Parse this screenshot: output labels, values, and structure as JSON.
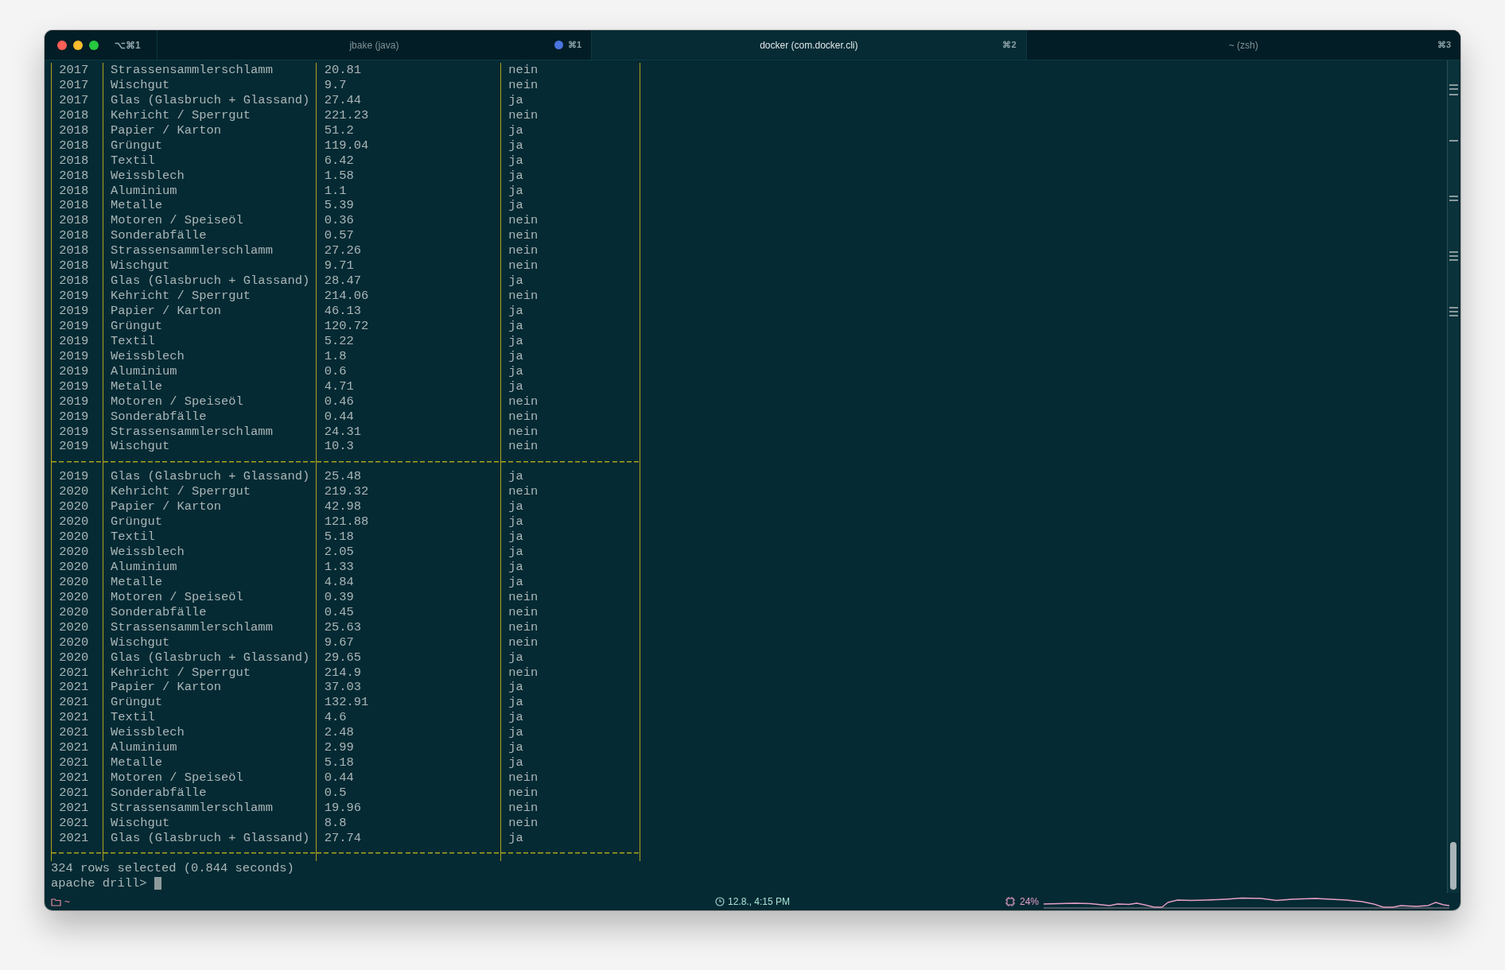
{
  "window": {
    "shortcut": "⌥⌘1"
  },
  "tabs": [
    {
      "title": "jbake (java)",
      "shortcut": "⌘1",
      "activity": true,
      "selected": false
    },
    {
      "title": "docker (com.docker.cli)",
      "shortcut": "⌘2",
      "activity": false,
      "selected": true
    },
    {
      "title": "~ (zsh)",
      "shortcut": "⌘3",
      "activity": false,
      "selected": false
    }
  ],
  "terminal": {
    "lines": [
      {
        "kind": "row",
        "cells": [
          "2017",
          "Strassensammlerschlamm",
          "20.81",
          "nein"
        ]
      },
      {
        "kind": "row",
        "cells": [
          "2017",
          "Wischgut",
          "9.7",
          "nein"
        ]
      },
      {
        "kind": "row",
        "cells": [
          "2017",
          "Glas (Glasbruch + Glassand)",
          "27.44",
          "ja"
        ]
      },
      {
        "kind": "row",
        "cells": [
          "2018",
          "Kehricht / Sperrgut",
          "221.23",
          "nein"
        ]
      },
      {
        "kind": "row",
        "cells": [
          "2018",
          "Papier / Karton",
          "51.2",
          "ja"
        ]
      },
      {
        "kind": "row",
        "cells": [
          "2018",
          "Grüngut",
          "119.04",
          "ja"
        ]
      },
      {
        "kind": "row",
        "cells": [
          "2018",
          "Textil",
          "6.42",
          "ja"
        ]
      },
      {
        "kind": "row",
        "cells": [
          "2018",
          "Weissblech",
          "1.58",
          "ja"
        ]
      },
      {
        "kind": "row",
        "cells": [
          "2018",
          "Aluminium",
          "1.1",
          "ja"
        ]
      },
      {
        "kind": "row",
        "cells": [
          "2018",
          "Metalle",
          "5.39",
          "ja"
        ]
      },
      {
        "kind": "row",
        "cells": [
          "2018",
          "Motoren / Speiseöl",
          "0.36",
          "nein"
        ]
      },
      {
        "kind": "row",
        "cells": [
          "2018",
          "Sonderabfälle",
          "0.57",
          "nein"
        ]
      },
      {
        "kind": "row",
        "cells": [
          "2018",
          "Strassensammlerschlamm",
          "27.26",
          "nein"
        ]
      },
      {
        "kind": "row",
        "cells": [
          "2018",
          "Wischgut",
          "9.71",
          "nein"
        ]
      },
      {
        "kind": "row",
        "cells": [
          "2018",
          "Glas (Glasbruch + Glassand)",
          "28.47",
          "ja"
        ]
      },
      {
        "kind": "row",
        "cells": [
          "2019",
          "Kehricht / Sperrgut",
          "214.06",
          "nein"
        ]
      },
      {
        "kind": "row",
        "cells": [
          "2019",
          "Papier / Karton",
          "46.13",
          "ja"
        ]
      },
      {
        "kind": "row",
        "cells": [
          "2019",
          "Grüngut",
          "120.72",
          "ja"
        ]
      },
      {
        "kind": "row",
        "cells": [
          "2019",
          "Textil",
          "5.22",
          "ja"
        ]
      },
      {
        "kind": "row",
        "cells": [
          "2019",
          "Weissblech",
          "1.8",
          "ja"
        ]
      },
      {
        "kind": "row",
        "cells": [
          "2019",
          "Aluminium",
          "0.6",
          "ja"
        ]
      },
      {
        "kind": "row",
        "cells": [
          "2019",
          "Metalle",
          "4.71",
          "ja"
        ]
      },
      {
        "kind": "row",
        "cells": [
          "2019",
          "Motoren / Speiseöl",
          "0.46",
          "nein"
        ]
      },
      {
        "kind": "row",
        "cells": [
          "2019",
          "Sonderabfälle",
          "0.44",
          "nein"
        ]
      },
      {
        "kind": "row",
        "cells": [
          "2019",
          "Strassensammlerschlamm",
          "24.31",
          "nein"
        ]
      },
      {
        "kind": "row",
        "cells": [
          "2019",
          "Wischgut",
          "10.3",
          "nein"
        ]
      },
      {
        "kind": "rule"
      },
      {
        "kind": "row",
        "cells": [
          "2019",
          "Glas (Glasbruch + Glassand)",
          "25.48",
          "ja"
        ]
      },
      {
        "kind": "row",
        "cells": [
          "2020",
          "Kehricht / Sperrgut",
          "219.32",
          "nein"
        ]
      },
      {
        "kind": "row",
        "cells": [
          "2020",
          "Papier / Karton",
          "42.98",
          "ja"
        ]
      },
      {
        "kind": "row",
        "cells": [
          "2020",
          "Grüngut",
          "121.88",
          "ja"
        ]
      },
      {
        "kind": "row",
        "cells": [
          "2020",
          "Textil",
          "5.18",
          "ja"
        ]
      },
      {
        "kind": "row",
        "cells": [
          "2020",
          "Weissblech",
          "2.05",
          "ja"
        ]
      },
      {
        "kind": "row",
        "cells": [
          "2020",
          "Aluminium",
          "1.33",
          "ja"
        ]
      },
      {
        "kind": "row",
        "cells": [
          "2020",
          "Metalle",
          "4.84",
          "ja"
        ]
      },
      {
        "kind": "row",
        "cells": [
          "2020",
          "Motoren / Speiseöl",
          "0.39",
          "nein"
        ]
      },
      {
        "kind": "row",
        "cells": [
          "2020",
          "Sonderabfälle",
          "0.45",
          "nein"
        ]
      },
      {
        "kind": "row",
        "cells": [
          "2020",
          "Strassensammlerschlamm",
          "25.63",
          "nein"
        ]
      },
      {
        "kind": "row",
        "cells": [
          "2020",
          "Wischgut",
          "9.67",
          "nein"
        ]
      },
      {
        "kind": "row",
        "cells": [
          "2020",
          "Glas (Glasbruch + Glassand)",
          "29.65",
          "ja"
        ]
      },
      {
        "kind": "row",
        "cells": [
          "2021",
          "Kehricht / Sperrgut",
          "214.9",
          "nein"
        ]
      },
      {
        "kind": "row",
        "cells": [
          "2021",
          "Papier / Karton",
          "37.03",
          "ja"
        ]
      },
      {
        "kind": "row",
        "cells": [
          "2021",
          "Grüngut",
          "132.91",
          "ja"
        ]
      },
      {
        "kind": "row",
        "cells": [
          "2021",
          "Textil",
          "4.6",
          "ja"
        ]
      },
      {
        "kind": "row",
        "cells": [
          "2021",
          "Weissblech",
          "2.48",
          "ja"
        ]
      },
      {
        "kind": "row",
        "cells": [
          "2021",
          "Aluminium",
          "2.99",
          "ja"
        ]
      },
      {
        "kind": "row",
        "cells": [
          "2021",
          "Metalle",
          "5.18",
          "ja"
        ]
      },
      {
        "kind": "row",
        "cells": [
          "2021",
          "Motoren / Speiseöl",
          "0.44",
          "nein"
        ]
      },
      {
        "kind": "row",
        "cells": [
          "2021",
          "Sonderabfälle",
          "0.5",
          "nein"
        ]
      },
      {
        "kind": "row",
        "cells": [
          "2021",
          "Strassensammlerschlamm",
          "19.96",
          "nein"
        ]
      },
      {
        "kind": "row",
        "cells": [
          "2021",
          "Wischgut",
          "8.8",
          "nein"
        ]
      },
      {
        "kind": "row",
        "cells": [
          "2021",
          "Glas (Glasbruch + Glassand)",
          "27.74",
          "ja"
        ]
      },
      {
        "kind": "rule"
      },
      {
        "kind": "text",
        "text": "324 rows selected (0.844 seconds)"
      },
      {
        "kind": "prompt",
        "text": "apache drill>"
      }
    ]
  },
  "status_bar": {
    "directory": "~",
    "clock": "12.8., 4:15 PM",
    "cpu": "24%"
  }
}
